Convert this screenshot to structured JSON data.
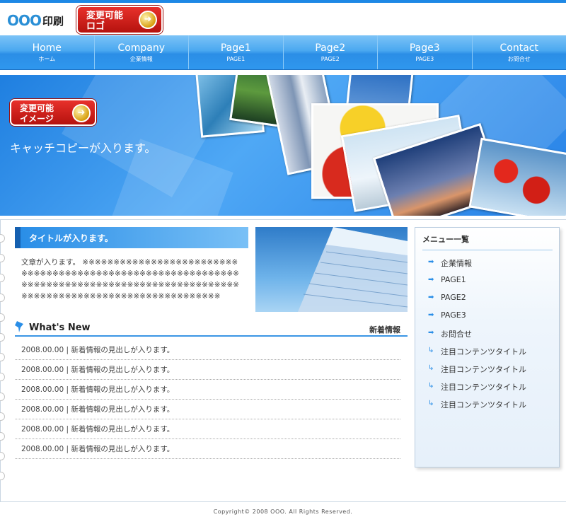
{
  "header": {
    "logo_mark": "OOO",
    "logo_text": "印刷",
    "badge_logo": [
      "変更可能",
      "ロゴ"
    ]
  },
  "nav": [
    {
      "label": "Home",
      "sub": "ホーム"
    },
    {
      "label": "Company",
      "sub": "企業情報"
    },
    {
      "label": "Page1",
      "sub": "PAGE1"
    },
    {
      "label": "Page2",
      "sub": "PAGE2"
    },
    {
      "label": "Page3",
      "sub": "PAGE3"
    },
    {
      "label": "Contact",
      "sub": "お問合せ"
    }
  ],
  "hero": {
    "badge_image": [
      "変更可能",
      "イメージ"
    ],
    "catch": "キャッチコピーが入ります。"
  },
  "main": {
    "title": "タイトルが入ります。",
    "body": "文章が入ります。 ※※※※※※※※※※※※※※※※※※※※※※※※※※※※※※※※※※※※※※※※※※※※※※※※※※※※※※※※※※※※※※※※※※※※※※※※※※※※※※※※※※※※※※※※※※※※※※※※※※※※※※※※※※※※※※※※※※※※※※※※※※※※※※※"
  },
  "news": {
    "title": "What's New",
    "label": "新着情報",
    "items": [
      "2008.00.00 | 新着情報の見出しが入ります。",
      "2008.00.00 | 新着情報の見出しが入ります。",
      "2008.00.00 | 新着情報の見出しが入ります。",
      "2008.00.00 | 新着情報の見出しが入ります。",
      "2008.00.00 | 新着情報の見出しが入ります。",
      "2008.00.00 | 新着情報の見出しが入ります。"
    ]
  },
  "sidebar": {
    "title": "メニュー一覧",
    "items": [
      {
        "label": "企業情報",
        "icon": "arrow-right-icon"
      },
      {
        "label": "PAGE1",
        "icon": "arrow-right-icon"
      },
      {
        "label": "PAGE2",
        "icon": "arrow-right-icon"
      },
      {
        "label": "PAGE3",
        "icon": "arrow-right-icon"
      },
      {
        "label": "お問合せ",
        "icon": "arrow-right-icon"
      },
      {
        "label": "注目コンテンツタイトル",
        "icon": "corner-arrow-icon"
      },
      {
        "label": "注目コンテンツタイトル",
        "icon": "corner-arrow-icon"
      },
      {
        "label": "注目コンテンツタイトル",
        "icon": "corner-arrow-icon"
      },
      {
        "label": "注目コンテンツタイトル",
        "icon": "corner-arrow-icon"
      }
    ]
  },
  "footer": "Copyright© 2008 OOO. All Rights Reserved.",
  "colors": {
    "accent": "#2a8ee7",
    "badge": "#c9140f",
    "nav": "#4aa8f0"
  }
}
